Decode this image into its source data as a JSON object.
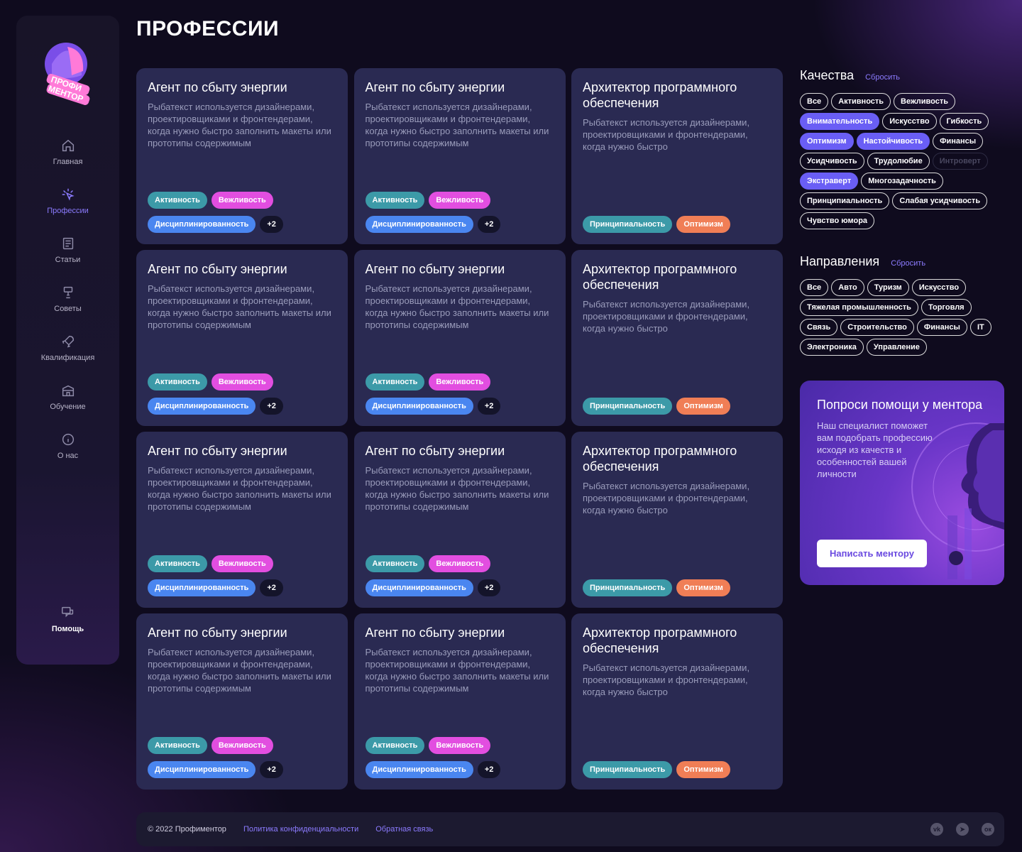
{
  "brand": {
    "logo_text": "ПРОФИ МЕНТОР"
  },
  "sidebar": {
    "items": [
      {
        "label": "Главная",
        "icon": "home-icon"
      },
      {
        "label": "Профессии",
        "icon": "sparkle-cursor-icon",
        "active": true
      },
      {
        "label": "Статьи",
        "icon": "article-icon"
      },
      {
        "label": "Советы",
        "icon": "lamp-icon"
      },
      {
        "label": "Квалификация",
        "icon": "rocket-icon"
      },
      {
        "label": "Обучение",
        "icon": "school-icon"
      },
      {
        "label": "О нас",
        "icon": "info-icon"
      }
    ],
    "help": {
      "label": "Помощь",
      "icon": "chat-icon"
    }
  },
  "page": {
    "title": "ПРОФЕССИИ"
  },
  "cards": [
    {
      "title": "Агент по сбыту энергии",
      "text": "Рыбатекст используется дизайнерами, проектировщиками и фронтендерами, когда нужно быстро заполнить макеты или прототипы содержимым",
      "tags": [
        "Активность",
        "Вежливость",
        "Дисциплинированность",
        "+2"
      ]
    },
    {
      "title": "Агент по сбыту энергии",
      "text": "Рыбатекст используется дизайнерами, проектировщиками и фронтендерами, когда нужно быстро заполнить макеты или прототипы содержимым",
      "tags": [
        "Активность",
        "Вежливость",
        "Дисциплинированность",
        "+2"
      ]
    },
    {
      "title": "Архитектор программного обеспечения",
      "text": "Рыбатекст используется дизайнерами, проектировщиками и фронтендерами, когда нужно быстро",
      "tags": [
        "Принципиальность",
        "Оптимизм"
      ]
    },
    {
      "title": "Агент по сбыту энергии",
      "text": "Рыбатекст используется дизайнерами, проектировщиками и фронтендерами, когда нужно быстро заполнить макеты или прототипы содержимым",
      "tags": [
        "Активность",
        "Вежливость",
        "Дисциплинированность",
        "+2"
      ]
    },
    {
      "title": "Агент по сбыту энергии",
      "text": "Рыбатекст используется дизайнерами, проектировщиками и фронтендерами, когда нужно быстро заполнить макеты или прототипы содержимым",
      "tags": [
        "Активность",
        "Вежливость",
        "Дисциплинированность",
        "+2"
      ]
    },
    {
      "title": "Архитектор программного обеспечения",
      "text": "Рыбатекст используется дизайнерами, проектировщиками и фронтендерами, когда нужно быстро",
      "tags": [
        "Принципиальность",
        "Оптимизм"
      ]
    },
    {
      "title": "Агент по сбыту энергии",
      "text": "Рыбатекст используется дизайнерами, проектировщиками и фронтендерами, когда нужно быстро заполнить макеты или прототипы содержимым",
      "tags": [
        "Активность",
        "Вежливость",
        "Дисциплинированность",
        "+2"
      ]
    },
    {
      "title": "Агент по сбыту энергии",
      "text": "Рыбатекст используется дизайнерами, проектировщиками и фронтендерами, когда нужно быстро заполнить макеты или прототипы содержимым",
      "tags": [
        "Активность",
        "Вежливость",
        "Дисциплинированность",
        "+2"
      ]
    },
    {
      "title": "Архитектор программного обеспечения",
      "text": "Рыбатекст используется дизайнерами, проектировщиками и фронтендерами, когда нужно быстро",
      "tags": [
        "Принципиальность",
        "Оптимизм"
      ]
    },
    {
      "title": "Агент по сбыту энергии",
      "text": "Рыбатекст используется дизайнерами, проектировщиками и фронтендерами, когда нужно быстро заполнить макеты или прототипы содержимым",
      "tags": [
        "Активность",
        "Вежливость",
        "Дисциплинированность",
        "+2"
      ]
    },
    {
      "title": "Агент по сбыту энергии",
      "text": "Рыбатекст используется дизайнерами, проектировщиками и фронтендерами, когда нужно быстро заполнить макеты или прототипы содержимым",
      "tags": [
        "Активность",
        "Вежливость",
        "Дисциплинированность",
        "+2"
      ]
    },
    {
      "title": "Архитектор программного обеспечения",
      "text": "Рыбатекст используется дизайнерами, проектировщиками и фронтендерами, когда нужно быстро",
      "tags": [
        "Принципиальность",
        "Оптимизм"
      ]
    }
  ],
  "qualities": {
    "title": "Качества",
    "reset": "Сбросить",
    "chips": [
      {
        "label": "Все",
        "state": "normal"
      },
      {
        "label": "Активность",
        "state": "normal"
      },
      {
        "label": "Вежливость",
        "state": "normal"
      },
      {
        "label": "Внимательность",
        "state": "on"
      },
      {
        "label": "Искусство",
        "state": "normal"
      },
      {
        "label": "Гибкость",
        "state": "normal"
      },
      {
        "label": "Оптимизм",
        "state": "on"
      },
      {
        "label": "Настойчивость",
        "state": "on"
      },
      {
        "label": "Финансы",
        "state": "normal"
      },
      {
        "label": "Усидчивость",
        "state": "normal"
      },
      {
        "label": "Трудолюбие",
        "state": "normal"
      },
      {
        "label": "Интроверт",
        "state": "off"
      },
      {
        "label": "Экстраверт",
        "state": "on"
      },
      {
        "label": "Многозадачность",
        "state": "normal"
      },
      {
        "label": "Принципиальность",
        "state": "normal"
      },
      {
        "label": "Слабая усидчивость",
        "state": "normal"
      },
      {
        "label": "Чувство юмора",
        "state": "normal"
      }
    ]
  },
  "directions": {
    "title": "Направления",
    "reset": "Сбросить",
    "chips": [
      {
        "label": "Все",
        "state": "normal"
      },
      {
        "label": "Авто",
        "state": "normal"
      },
      {
        "label": "Туризм",
        "state": "normal"
      },
      {
        "label": "Искусство",
        "state": "normal"
      },
      {
        "label": "Тяжелая промышленность",
        "state": "normal"
      },
      {
        "label": "Торговля",
        "state": "normal"
      },
      {
        "label": "Связь",
        "state": "normal"
      },
      {
        "label": "Строительство",
        "state": "normal"
      },
      {
        "label": "Финансы",
        "state": "normal"
      },
      {
        "label": "IT",
        "state": "normal"
      },
      {
        "label": "Электроника",
        "state": "normal"
      },
      {
        "label": "Управление",
        "state": "normal"
      }
    ]
  },
  "mentor": {
    "title": "Попроси помощи у ментора",
    "text": "Наш специалист поможет вам подобрать профессию исходя из качеств и особенностей вашей личности",
    "button": "Написать ментору"
  },
  "footer": {
    "copyright": "© 2022 Профиментор",
    "privacy": "Политика конфиденциальности",
    "feedback": "Обратная связь",
    "social": [
      "vk-icon",
      "telegram-icon",
      "odnoklassniki-icon"
    ]
  },
  "colors": {
    "accent": "#8c7bff",
    "card_bg": "#2a2a52",
    "tag_teal": "#3c9aa8",
    "tag_pink": "#e24ee0",
    "tag_blue": "#4a86f0",
    "tag_orange": "#f07e56",
    "chip_on": "#6a5ef5"
  }
}
